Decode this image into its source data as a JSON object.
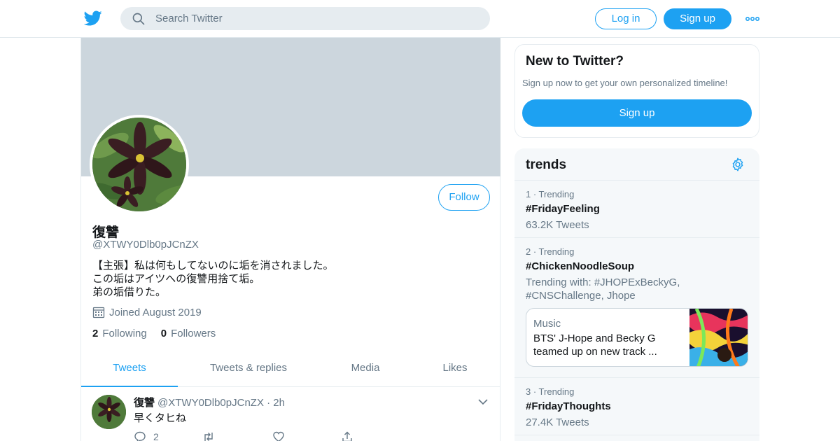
{
  "header": {
    "search_placeholder": "Search Twitter",
    "login_label": "Log in",
    "signup_label": "Sign up"
  },
  "profile": {
    "name": "復讐",
    "handle": "@XTWY0Dlb0pJCnZX",
    "follow_label": "Follow",
    "bio_lines": [
      "【主張】私は何もしてないのに垢を消されました。",
      "この垢はアイツへの復讐用捨て垢。",
      "弟の垢借りた。"
    ],
    "joined": "Joined August 2019",
    "following_count": "2",
    "following_label": "Following",
    "followers_count": "0",
    "followers_label": "Followers"
  },
  "tabs": [
    {
      "label": "Tweets",
      "active": true
    },
    {
      "label": "Tweets & replies",
      "active": false
    },
    {
      "label": "Media",
      "active": false
    },
    {
      "label": "Likes",
      "active": false
    }
  ],
  "tweet": {
    "name": "復讐",
    "handle": "@XTWY0Dlb0pJCnZX",
    "time": "· 2h",
    "text": "早くタヒね",
    "reply_count": "2"
  },
  "new_to_twitter": {
    "title": "New to Twitter?",
    "subtitle": "Sign up now to get your own personalized timeline!",
    "button_label": "Sign up"
  },
  "trends": {
    "title": "trends",
    "items": [
      {
        "meta": "1 · Trending",
        "name": "#FridayFeeling",
        "sub": "63.2K Tweets"
      },
      {
        "meta": "2 · Trending",
        "name": "#ChickenNoodleSoup",
        "sub": "Trending with: #JHOPExBeckyG, #CNSChallenge, Jhope",
        "card": {
          "category": "Music",
          "title": "BTS' J-Hope and Becky G teamed up on new track ..."
        }
      },
      {
        "meta": "3 · Trending",
        "name": "#FridayThoughts",
        "sub": "27.4K Tweets"
      }
    ]
  },
  "colors": {
    "accent": "#1da1f2",
    "banner": "#ccd6dd",
    "muted_text": "#657786"
  }
}
